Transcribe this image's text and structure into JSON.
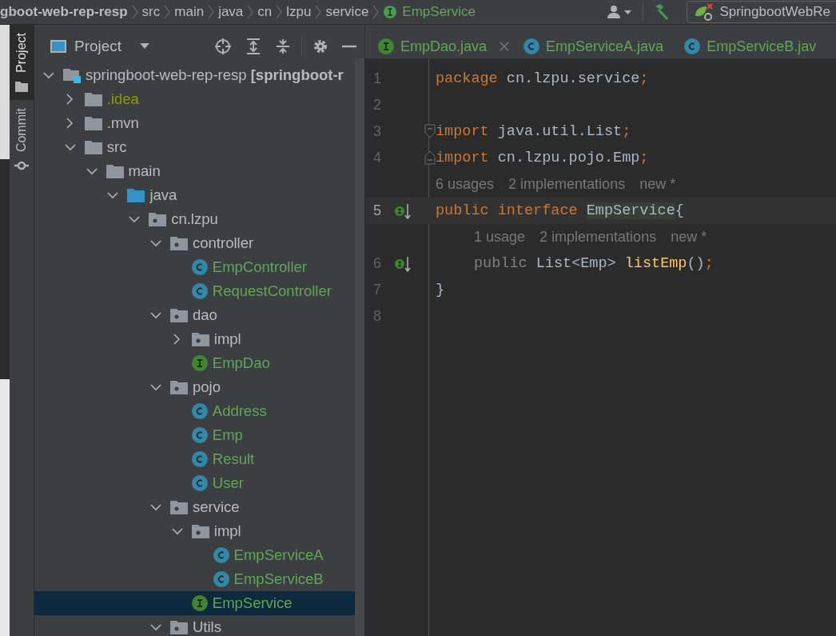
{
  "breadcrumbs": [
    {
      "label": "gboot-web-rep-resp",
      "kind": "module"
    },
    {
      "label": "src",
      "kind": "folder"
    },
    {
      "label": "main",
      "kind": "folder"
    },
    {
      "label": "java",
      "kind": "folder"
    },
    {
      "label": "cn",
      "kind": "folder"
    },
    {
      "label": "lzpu",
      "kind": "folder"
    },
    {
      "label": "service",
      "kind": "folder"
    },
    {
      "label": "EmpService",
      "kind": "interface"
    }
  ],
  "run_config": {
    "label": "SpringbootWebRe"
  },
  "tool_tabs": [
    {
      "label": "Project",
      "selected": true
    },
    {
      "label": "Commit",
      "selected": false
    }
  ],
  "project": {
    "title": "Project",
    "tree": [
      {
        "label": "springboot-web-rep-resp **[springboot-r**",
        "kind": "module",
        "expanded": true,
        "selected": false,
        "color": "#bbbbbb",
        "children": [
          {
            "label": ".idea",
            "kind": "folder",
            "expanded": false,
            "selected": false,
            "color": "#999900"
          },
          {
            "label": ".mvn",
            "kind": "folder",
            "expanded": false,
            "selected": false,
            "color": "#bbbbbb"
          },
          {
            "label": "src",
            "kind": "folder",
            "expanded": true,
            "selected": false,
            "color": "#bbbbbb",
            "children": [
              {
                "label": "main",
                "kind": "folder",
                "expanded": true,
                "selected": false,
                "color": "#bbbbbb",
                "children": [
                  {
                    "label": "java",
                    "kind": "source",
                    "expanded": true,
                    "selected": false,
                    "color": "#bbbbbb",
                    "children": [
                      {
                        "label": "cn.lzpu",
                        "kind": "package",
                        "expanded": true,
                        "selected": false,
                        "color": "#bbbbbb",
                        "children": [
                          {
                            "label": "controller",
                            "kind": "package",
                            "expanded": true,
                            "selected": false,
                            "color": "#bbbbbb",
                            "children": [
                              {
                                "label": "EmpController",
                                "kind": "class",
                                "selected": false,
                                "color": "#62a555"
                              },
                              {
                                "label": "RequestController",
                                "kind": "class",
                                "selected": false,
                                "color": "#62a555"
                              }
                            ]
                          },
                          {
                            "label": "dao",
                            "kind": "package",
                            "expanded": true,
                            "selected": false,
                            "color": "#bbbbbb",
                            "children": [
                              {
                                "label": "impl",
                                "kind": "package",
                                "expanded": false,
                                "selected": false,
                                "color": "#bbbbbb"
                              },
                              {
                                "label": "EmpDao",
                                "kind": "interface",
                                "selected": false,
                                "color": "#62a555"
                              }
                            ]
                          },
                          {
                            "label": "pojo",
                            "kind": "package",
                            "expanded": true,
                            "selected": false,
                            "color": "#bbbbbb",
                            "children": [
                              {
                                "label": "Address",
                                "kind": "class",
                                "selected": false,
                                "color": "#62a555"
                              },
                              {
                                "label": "Emp",
                                "kind": "class",
                                "selected": false,
                                "color": "#62a555"
                              },
                              {
                                "label": "Result",
                                "kind": "class",
                                "selected": false,
                                "color": "#62a555"
                              },
                              {
                                "label": "User",
                                "kind": "class",
                                "selected": false,
                                "color": "#62a555"
                              }
                            ]
                          },
                          {
                            "label": "service",
                            "kind": "package",
                            "expanded": true,
                            "selected": false,
                            "color": "#bbbbbb",
                            "children": [
                              {
                                "label": "impl",
                                "kind": "package",
                                "expanded": true,
                                "selected": false,
                                "color": "#bbbbbb",
                                "children": [
                                  {
                                    "label": "EmpServiceA",
                                    "kind": "class",
                                    "selected": false,
                                    "color": "#62a555"
                                  },
                                  {
                                    "label": "EmpServiceB",
                                    "kind": "class",
                                    "selected": false,
                                    "color": "#62a555"
                                  }
                                ]
                              },
                              {
                                "label": "EmpService",
                                "kind": "interface",
                                "selected": true,
                                "color": "#62a555"
                              }
                            ]
                          },
                          {
                            "label": "Utils",
                            "kind": "package",
                            "expanded": true,
                            "selected": false,
                            "color": "#bbbbbb"
                          }
                        ]
                      }
                    ]
                  }
                ]
              }
            ]
          }
        ]
      }
    ]
  },
  "editor_tabs": [
    {
      "label": "EmpDao.java",
      "kind": "interface",
      "closable": true,
      "selected": false
    },
    {
      "label": "EmpServiceA.java",
      "kind": "class",
      "closable": false,
      "selected": false
    },
    {
      "label": "EmpServiceB.jav",
      "kind": "class",
      "closable": false,
      "selected": false
    }
  ],
  "code": [
    {
      "kind": "code",
      "number": "1",
      "current": false,
      "tokens": [
        {
          "t": "package ",
          "kind": "keyword"
        },
        {
          "t": "cn.lzpu.service",
          "kind": "plain"
        },
        {
          "t": ";",
          "kind": "punct"
        }
      ]
    },
    {
      "kind": "code",
      "number": "2",
      "current": false
    },
    {
      "kind": "code",
      "number": "3",
      "current": false,
      "fold_start": true,
      "tokens": [
        {
          "t": "import ",
          "kind": "keyword"
        },
        {
          "t": "java.util.List",
          "kind": "plain"
        },
        {
          "t": ";",
          "kind": "punct"
        }
      ]
    },
    {
      "kind": "code",
      "number": "4",
      "current": false,
      "fold_end": true,
      "tokens": [
        {
          "t": "import ",
          "kind": "keyword"
        },
        {
          "t": "cn.lzpu.pojo.Emp",
          "kind": "plain"
        },
        {
          "t": ";",
          "kind": "punct"
        }
      ]
    },
    {
      "kind": "hint",
      "indent": false,
      "parts": [
        "6 usages",
        "2 implementations",
        "new *"
      ]
    },
    {
      "kind": "code",
      "number": "5",
      "current": true,
      "implemented": true,
      "tokens": [
        {
          "t": "public interface ",
          "kind": "keyword"
        },
        {
          "t": "EmpService",
          "kind": "highlight"
        },
        {
          "t": "{",
          "kind": "plain"
        }
      ]
    },
    {
      "kind": "hint",
      "indent": true,
      "parts": [
        "1 usage",
        "2 implementations",
        "new *"
      ]
    },
    {
      "kind": "code",
      "number": "6",
      "current": false,
      "implemented": true,
      "indent": true,
      "tokens": [
        {
          "t": "public ",
          "kind": "redundant"
        },
        {
          "t": "List<Emp> ",
          "kind": "plain"
        },
        {
          "t": "listEmp",
          "kind": "method"
        },
        {
          "t": "()",
          "kind": "plain"
        },
        {
          "t": ";",
          "kind": "punct"
        }
      ]
    },
    {
      "kind": "code",
      "number": "7",
      "current": false,
      "tokens": [
        {
          "t": "}",
          "kind": "plain"
        }
      ]
    },
    {
      "kind": "code",
      "number": "8",
      "current": false
    }
  ]
}
